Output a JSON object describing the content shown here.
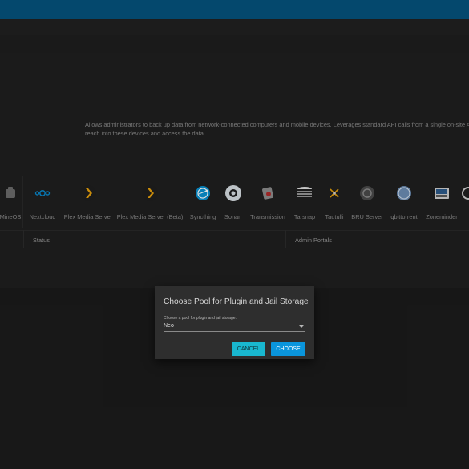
{
  "page": {
    "description_line1": "Allows administrators to back up data from network-connected computers and mobile devices. Leverages standard API calls from a single on-site Asigra se",
    "description_line2": "reach into these devices and access the data."
  },
  "plugins": [
    {
      "label": "MineOS",
      "icon": "mineos-icon"
    },
    {
      "label": "Nextcloud",
      "icon": "nextcloud-icon"
    },
    {
      "label": "Plex Media Server",
      "icon": "plex-icon"
    },
    {
      "label": "Plex Media Server (Beta)",
      "icon": "plex-beta-icon"
    },
    {
      "label": "Syncthing",
      "icon": "syncthing-icon"
    },
    {
      "label": "Sonarr",
      "icon": "sonarr-icon"
    },
    {
      "label": "Transmission",
      "icon": "transmission-icon"
    },
    {
      "label": "Tarsnap",
      "icon": "tarsnap-icon"
    },
    {
      "label": "Tautulli",
      "icon": "tautulli-icon"
    },
    {
      "label": "BRU Server",
      "icon": "bru-server-icon"
    },
    {
      "label": "qbittorrent",
      "icon": "qbittorrent-icon"
    },
    {
      "label": "Zoneminder",
      "icon": "zoneminder-icon"
    }
  ],
  "table": {
    "col_status": "Status",
    "col_admin": "Admin Portals"
  },
  "dialog": {
    "title": "Choose Pool for Plugin and Jail Storage",
    "select_label": "Choose a pool for plugin and jail storage.",
    "select_value": "Neo",
    "cancel_label": "CANCEL",
    "choose_label": "CHOOSE"
  },
  "colors": {
    "topbar": "#05527d",
    "cancel_button": "#19b7cf",
    "choose_button": "#0a95dc"
  }
}
